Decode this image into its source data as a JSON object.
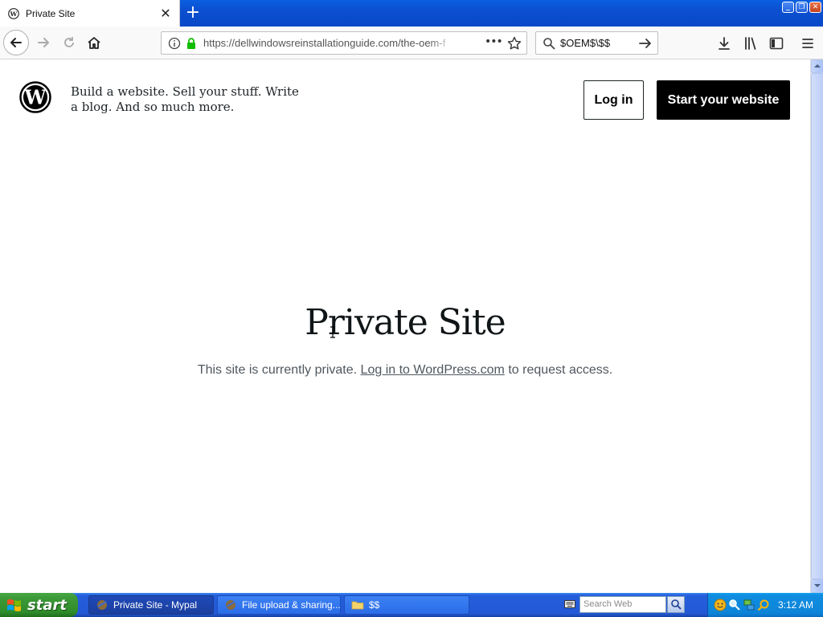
{
  "browser": {
    "tab": {
      "title": "Private Site"
    },
    "url": "https://dellwindowsreinstallationguide.com/the-oem-f",
    "search_query": "$OEM$\\$$"
  },
  "page": {
    "tagline": "Build a website. Sell your stuff. Write a blog. And so much more.",
    "login_label": "Log in",
    "start_label": "Start your website",
    "title": "Private Site",
    "message_before": "This site is currently private.",
    "message_link": "Log in to WordPress.com",
    "message_after": "to request access."
  },
  "taskbar": {
    "start_label": "start",
    "items": [
      {
        "label": "Private Site - Mypal"
      },
      {
        "label": "File upload & sharing...."
      },
      {
        "label": "$$"
      }
    ],
    "search_placeholder": "Search Web",
    "clock": "3:12 AM"
  },
  "colors": {
    "titlebar": "#0a5fe0",
    "button_black": "#000000",
    "taskbar_blue": "#245edb",
    "start_green": "#3c9a38"
  },
  "icons": [
    "wordpress-icon",
    "close-icon",
    "plus-icon",
    "back-arrow-icon",
    "forward-arrow-icon",
    "reload-icon",
    "home-icon",
    "info-icon",
    "lock-icon",
    "page-actions-icon",
    "star-icon",
    "search-icon",
    "go-arrow-icon",
    "download-icon",
    "library-icon",
    "sidebar-icon",
    "hamburger-menu-icon",
    "windows-flag-icon",
    "folder-icon",
    "keyboard-icon",
    "clock-tray-icons"
  ]
}
